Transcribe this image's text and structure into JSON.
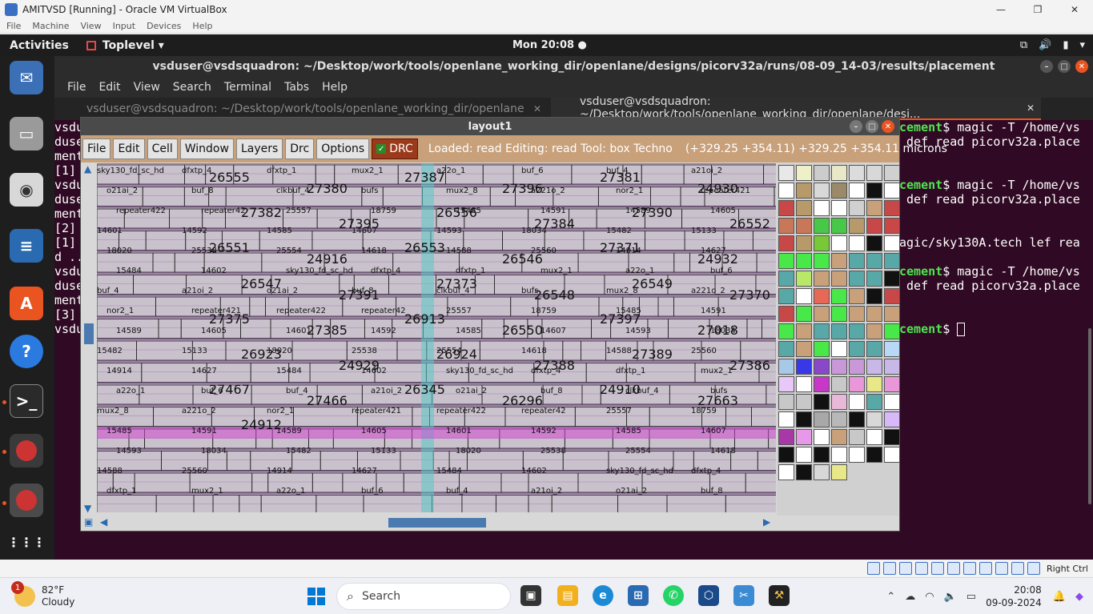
{
  "vbox": {
    "title": "AMITVSD [Running] - Oracle VM VirtualBox",
    "menu": [
      "File",
      "Machine",
      "View",
      "Input",
      "Devices",
      "Help"
    ],
    "host_key": "Right Ctrl"
  },
  "gnome": {
    "activities": "Activities",
    "app_name": "Toplevel ▾",
    "clock": "Mon 20:08 ●"
  },
  "terminal": {
    "title": "vsduser@vsdsquadron: ~/Desktop/work/tools/openlane_working_dir/openlane/designs/picorv32a/runs/08-09_14-03/results/placement",
    "menu": [
      "File",
      "Edit",
      "View",
      "Search",
      "Terminal",
      "Tabs",
      "Help"
    ],
    "tabs": [
      {
        "label": "vsduser@vsdsquadron: ~/Desktop/work/tools/openlane_working_dir/openlane",
        "active": false
      },
      {
        "label": "vsduser@vsdsquadron: ~/Desktop/work/tools/openlane_working_dir/openlane/desi...",
        "active": true
      }
    ],
    "left_lines": [
      "vsdu",
      "duse",
      "ment",
      "[1]",
      "vsdu",
      "duse",
      "ment",
      "[2]",
      "[1]",
      "d ..",
      "vsdu",
      "duse",
      "ment",
      "[3]",
      "vsdu"
    ],
    "right_lines": [
      {
        "prompt": "cement",
        "text": "$ magic -T /home/vs"
      },
      {
        "prompt": "",
        "text": " def read picorv32a.place"
      },
      {
        "prompt": "",
        "text": ""
      },
      {
        "prompt": "",
        "text": ""
      },
      {
        "prompt": "cement",
        "text": "$ magic -T /home/vs"
      },
      {
        "prompt": "",
        "text": " def read picorv32a.place"
      },
      {
        "prompt": "",
        "text": ""
      },
      {
        "prompt": "",
        "text": ""
      },
      {
        "prompt": "",
        "text": "agic/sky130A.tech lef rea"
      },
      {
        "prompt": "",
        "text": ""
      },
      {
        "prompt": "cement",
        "text": "$ magic -T /home/vs"
      },
      {
        "prompt": "",
        "text": " def read picorv32a.place"
      },
      {
        "prompt": "",
        "text": ""
      },
      {
        "prompt": "",
        "text": ""
      },
      {
        "prompt": "cement",
        "text": "$ "
      }
    ]
  },
  "magic": {
    "title": "layout1",
    "menu": [
      "File",
      "Edit",
      "Cell",
      "Window",
      "Layers",
      "Drc",
      "Options"
    ],
    "drc_label": "DRC",
    "status": "Loaded: read Editing: read Tool: box  Techno",
    "coords": "(+329.25 +354.11) +329.25 +354.11 microns",
    "big_labels": [
      "26555",
      "27380",
      "27387",
      "27396",
      "27381",
      "24930",
      "27382",
      "27395",
      "26556",
      "27384",
      "27390",
      "26552",
      "26551",
      "24916",
      "26553",
      "26546",
      "27371",
      "24932",
      "26547",
      "27391",
      "27373",
      "26548",
      "26549",
      "27370",
      "27375",
      "27385",
      "26913",
      "26550",
      "27397",
      "27018",
      "26923",
      "24929",
      "26924",
      "27388",
      "27389",
      "27386",
      "27467",
      "27466",
      "26345",
      "26296",
      "24910",
      "27663",
      "24912"
    ],
    "small_labels": [
      "sky130_fd_sc_hd",
      "dfxtp_4",
      "dfxtp_1",
      "mux2_1",
      "a22o_1",
      "buf_6",
      "buf_4",
      "a21oi_2",
      "o21ai_2",
      "buf_8",
      "clkbuf_4",
      "bufs",
      "mux2_8",
      "a221o_2",
      "nor2_1",
      "repeater421",
      "repeater422",
      "repeater42",
      "25557",
      "18759",
      "15485",
      "14591",
      "14589",
      "14605",
      "14601",
      "14592",
      "14585",
      "14607",
      "14593",
      "18034",
      "15482",
      "15133",
      "18020",
      "25538",
      "25554",
      "14618",
      "14588",
      "25560",
      "14914",
      "14627",
      "15484",
      "14602"
    ],
    "palette_colors": [
      "#e8e8e8",
      "#f0f0c8",
      "#cccccc",
      "#e8e8c8",
      "#dcdcdc",
      "#d8d8d8",
      "#d0d0d0",
      "#ffffff",
      "#b89a6a",
      "#d8d8d8",
      "#9a8a6a",
      "#ffffff",
      "#ffffff",
      "#ffffff",
      "#c84848",
      "#b89a6a",
      "#ffffff",
      "#ffffff",
      "#d0d0d0",
      "#c8a07a",
      "#c84848",
      "#c87858",
      "#c87858",
      "#48c848",
      "#48c848",
      "#b89a6a",
      "#c84848",
      "#c84848",
      "#c84848",
      "#b89a6a",
      "#78c838",
      "#ffffff",
      "#ffffff",
      "#ffffff",
      "#ffffff",
      "#48e848",
      "#48e848",
      "#48e848",
      "#c8a07a",
      "#58a8a8",
      "#58a8a8",
      "#58a8a8",
      "#58a8a8",
      "#b8e868",
      "#c8a07a",
      "#c8a07a",
      "#58a8a8",
      "#58a8a8",
      "#ffffff",
      "#58a8a8",
      "#ffffff",
      "#e86858",
      "#48e848",
      "#c8a07a",
      "#ffffff",
      "#c84848",
      "#c84848",
      "#48e848",
      "#c8a07a",
      "#48e848",
      "#c8a07a",
      "#c8a07a",
      "#c8a07a",
      "#48e848",
      "#c8a07a",
      "#58a8a8",
      "#58a8a8",
      "#58a8a8",
      "#c8a07a",
      "#48e848",
      "#58a8a8",
      "#c8a07a",
      "#48e848",
      "#ffffff",
      "#58a8a8",
      "#58a8a8",
      "#b8d8f8",
      "#a8c8e8",
      "#3838e8",
      "#8848c8",
      "#c898d8",
      "#c898d8",
      "#c8b8e8",
      "#c8b8e8",
      "#e8c8f8",
      "#ffffff",
      "#c838c8",
      "#c8c8c8",
      "#e898d8",
      "#e8e888",
      "#e898d8",
      "#c8c8c8",
      "#c8c8c8",
      "#ffffff",
      "#e8b8d8",
      "#ffffff",
      "#58a8a8",
      "#ffffff",
      "#ffffff",
      "#ffffff",
      "#a8a8a8",
      "#b8b8b8",
      "#ffffff",
      "#d8d8d8",
      "#d8b8f8",
      "#a838a8",
      "#e898e8",
      "#ffffff",
      "#c8a07a",
      "#c8c8c8",
      "#ffffff",
      "#ffffff",
      "#111111",
      "#ffffff",
      "#ffffff",
      "#ffffff",
      "#ffffff",
      "#ffffff",
      "#ffffff",
      "#ffffff",
      "#ffffff",
      "#d8d8d8",
      "#e8e888"
    ]
  },
  "taskbar": {
    "temp": "82°F",
    "weather": "Cloudy",
    "badge": "1",
    "search": "Search",
    "time": "20:08",
    "date": "09-09-2024"
  }
}
